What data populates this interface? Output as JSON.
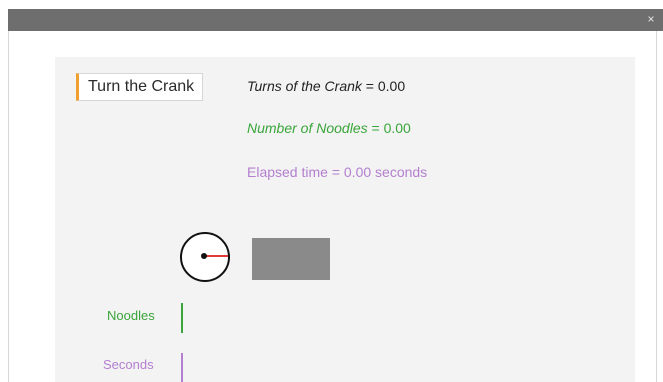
{
  "window": {
    "close_glyph": "×"
  },
  "crank": {
    "button_label": "Turn the Crank"
  },
  "readouts": {
    "turns_label": "Turns of the Crank",
    "turns_value": "= 0.00",
    "noodles_label": "Number of Noodles",
    "noodles_value": "= 0.00",
    "elapsed_label": "Elapsed time",
    "elapsed_value": "= 0.00 seconds"
  },
  "bars": {
    "noodles_label": "Noodles",
    "seconds_label": "Seconds"
  },
  "colors": {
    "titlebar": "#6e6e6e",
    "panel": "#f3f3f3",
    "button_accent": "#f0a030",
    "noodles": "#3aa53a",
    "elapsed": "#b37fd0",
    "crank_arm": "#e23a3a",
    "noodle_box": "#8a8a8a"
  }
}
